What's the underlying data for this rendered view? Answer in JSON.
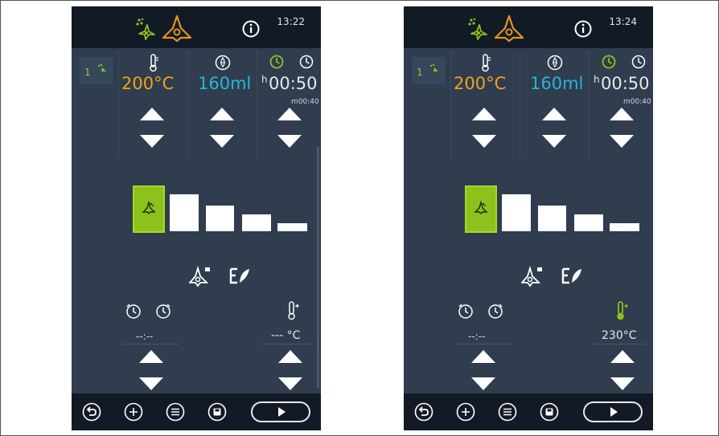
{
  "screens": [
    {
      "clock": "13:22",
      "step_number": "1",
      "temperature": "200°C",
      "humidity": "160ml",
      "time_main_prefix": "h",
      "time_main": "00:50",
      "time_sub": "m00:40",
      "delay_time": "--:--",
      "core_temp": "--- °C",
      "core_probe_active": false
    },
    {
      "clock": "13:24",
      "step_number": "1",
      "temperature": "200°C",
      "humidity": "160ml",
      "time_main_prefix": "h",
      "time_main": "00:50",
      "time_sub": "m00:40",
      "delay_time": "--:--",
      "core_temp": "230°C",
      "core_probe_active": true
    }
  ],
  "fan_speed_levels": 5,
  "fan_speed_selected": 1,
  "colors": {
    "screen_bg": "#2f3d4e",
    "bar_bg": "#121a26",
    "accent_green": "#8cc21b",
    "temp_orange": "#f0a21d",
    "humidity_cyan": "#27b6d8"
  },
  "icons": {
    "top": [
      "steam-icon",
      "fan-icon",
      "info-icon"
    ],
    "params": [
      "thermometer-icon",
      "humidity-drop-icon",
      "cook-time-icon",
      "total-time-icon"
    ],
    "bottom": [
      "back-icon",
      "add-icon",
      "menu-icon",
      "save-icon",
      "start-icon"
    ]
  }
}
